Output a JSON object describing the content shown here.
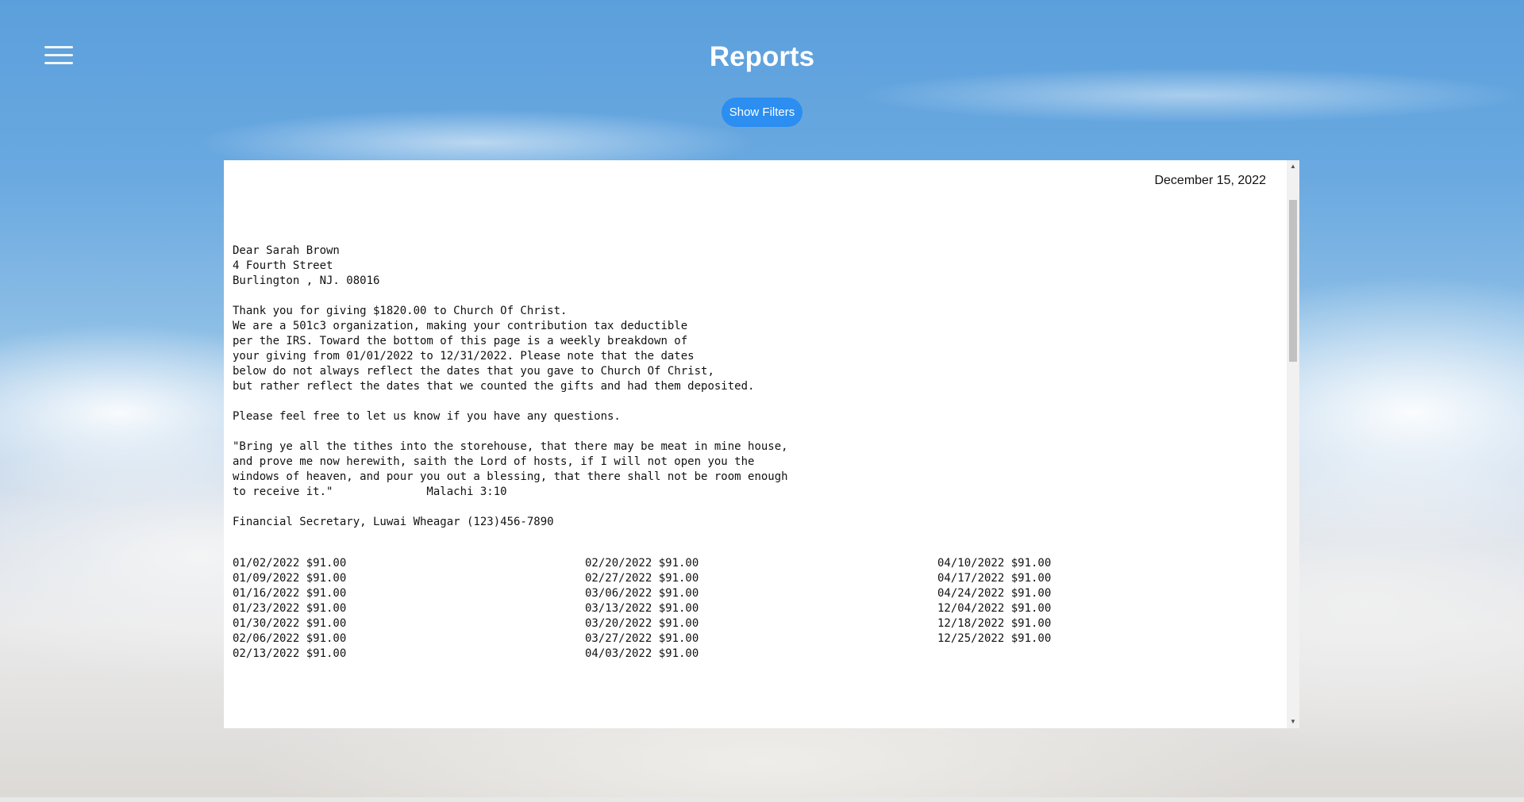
{
  "header": {
    "title": "Reports",
    "filters_button": "Show Filters",
    "menu_icon": "hamburger-menu-icon"
  },
  "report": {
    "date": "December 15, 2022",
    "letter_lines": [
      "Dear Sarah Brown",
      "4 Fourth Street",
      "Burlington , NJ. 08016",
      "",
      "Thank you for giving $1820.00 to Church Of Christ.",
      "We are a 501c3 organization, making your contribution tax deductible",
      "per the IRS. Toward the bottom of this page is a weekly breakdown of",
      "your giving from 01/01/2022 to 12/31/2022. Please note that the dates",
      "below do not always reflect the dates that you gave to Church Of Christ,",
      "but rather reflect the dates that we counted the gifts and had them deposited.",
      "",
      "Please feel free to let us know if you have any questions.",
      "",
      "\"Bring ye all the tithes into the storehouse, that there may be meat in mine house,",
      "and prove me now herewith, saith the Lord of hosts, if I will not open you the",
      "windows of heaven, and pour you out a blessing, that there shall not be room enough",
      "to receive it.\"              Malachi 3:10",
      "",
      "Financial Secretary, Luwai Wheagar (123)456-7890"
    ],
    "giving_columns": [
      [
        "01/02/2022 $91.00",
        "01/09/2022 $91.00",
        "01/16/2022 $91.00",
        "01/23/2022 $91.00",
        "01/30/2022 $91.00",
        "02/06/2022 $91.00",
        "02/13/2022 $91.00"
      ],
      [
        "02/20/2022 $91.00",
        "02/27/2022 $91.00",
        "03/06/2022 $91.00",
        "03/13/2022 $91.00",
        "03/20/2022 $91.00",
        "03/27/2022 $91.00",
        "04/03/2022 $91.00"
      ],
      [
        "04/10/2022 $91.00",
        "04/17/2022 $91.00",
        "04/24/2022 $91.00",
        "12/04/2022 $91.00",
        "12/18/2022 $91.00",
        "12/25/2022 $91.00"
      ]
    ]
  }
}
